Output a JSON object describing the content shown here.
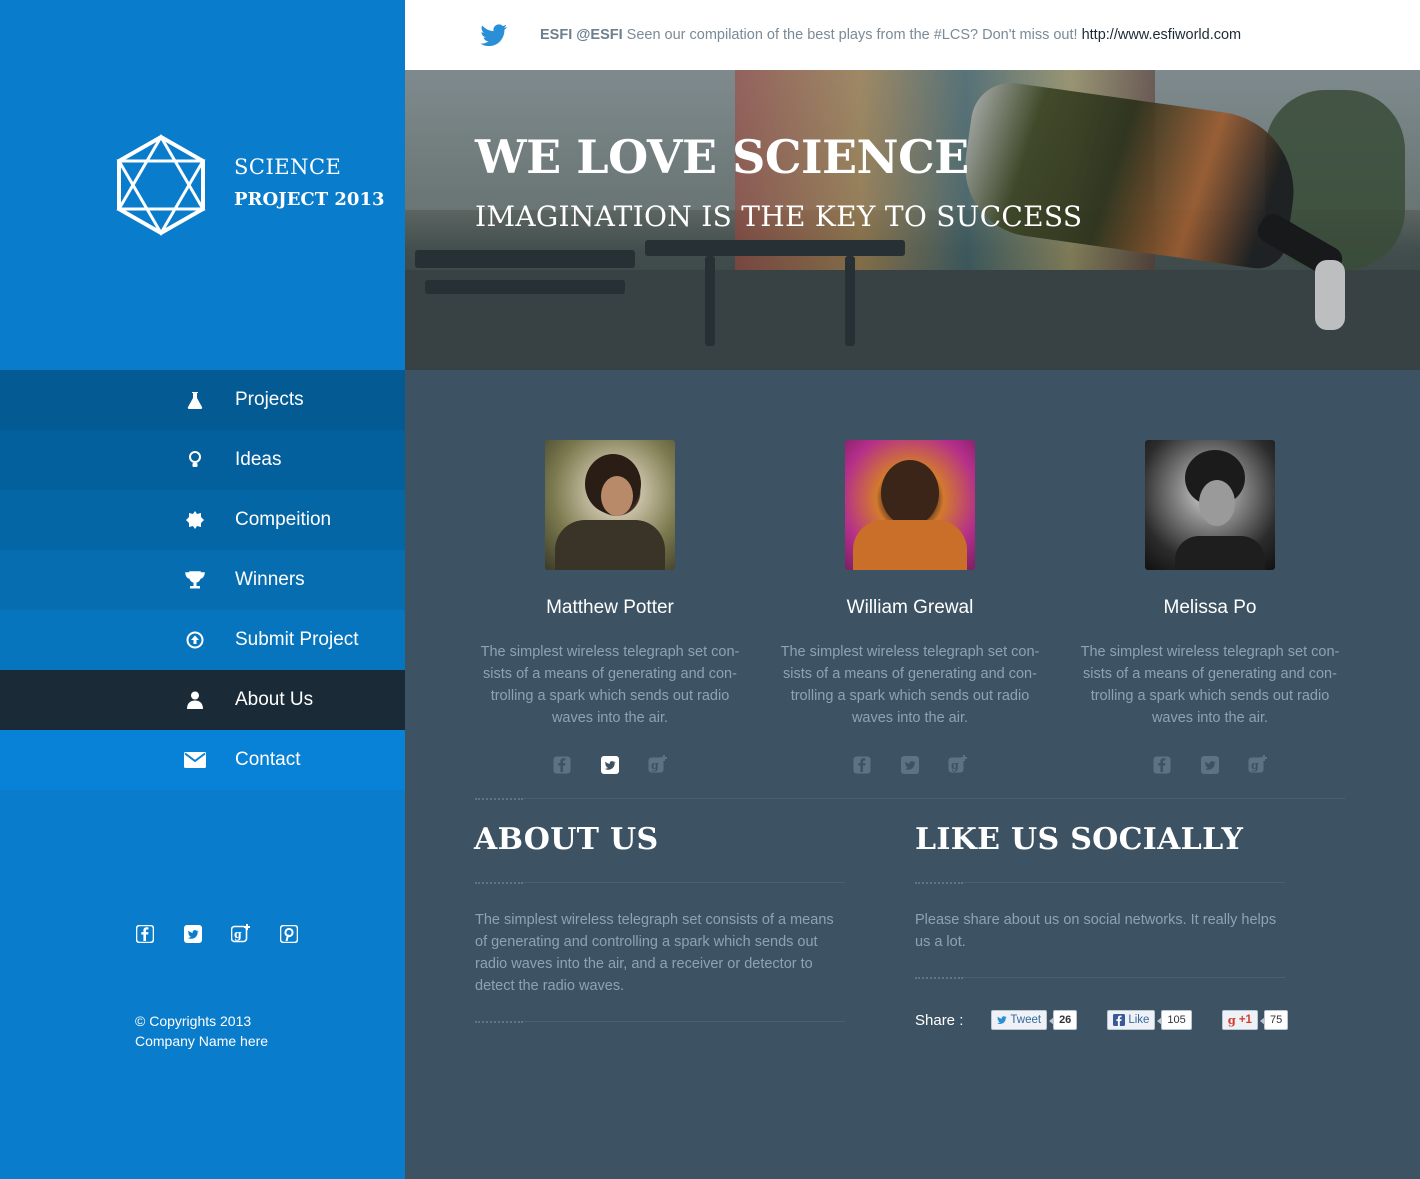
{
  "brand": {
    "line1": "SCIENCE",
    "line2": "PROJECT 2013"
  },
  "nav": [
    {
      "label": "Projects",
      "icon": "flask-icon"
    },
    {
      "label": "Ideas",
      "icon": "lightbulb-icon"
    },
    {
      "label": "Compeition",
      "icon": "badge-icon"
    },
    {
      "label": "Winners",
      "icon": "trophy-icon"
    },
    {
      "label": "Submit Project",
      "icon": "upload-circle-icon"
    },
    {
      "label": "About Us",
      "icon": "user-icon",
      "active": true
    },
    {
      "label": "Contact",
      "icon": "envelope-icon"
    }
  ],
  "footer": {
    "copyright": "© Copyrights 2013",
    "company": "Company Name here"
  },
  "twitter": {
    "handle": "ESFI @ESFI",
    "text": "Seen our compilation of the best plays from the #LCS? Don't miss out!",
    "link": "http://www.esfiworld.com"
  },
  "hero": {
    "title_light": "WE LOVE",
    "title_bold": "SCIENCE",
    "subtitle": "IMAGINATION IS THE KEY TO SUCCESS"
  },
  "team": [
    {
      "name": "Matthew Potter",
      "bio": "The simplest wireless telegraph set con-sists of a means of generating and con-trolling a spark which sends out radio waves into the air."
    },
    {
      "name": "William Grewal",
      "bio": "The simplest wireless telegraph set con-sists of a means of generating and con-trolling a spark which sends out radio waves into the air."
    },
    {
      "name": "Melissa Po",
      "bio": "The simplest wireless telegraph set con-sists of a means of generating and con-trolling a spark which sends out radio waves into the air."
    }
  ],
  "about": {
    "title": "ABOUT US",
    "text": "The simplest wireless telegraph set consists of a means of generating and controlling a spark which sends out radio waves into the air, and a receiver or detector to detect the radio waves."
  },
  "social": {
    "title_light": "LIKE US",
    "title_bold": "SOCIALLY",
    "text": "Please share about us on social networks. It really helps us a lot.",
    "share_label": "Share :",
    "tweet": {
      "label": "Tweet",
      "count": "26"
    },
    "like": {
      "label": "Like",
      "count": "105"
    },
    "plus": {
      "label": "+1",
      "count": "75"
    }
  },
  "colors": {
    "sidebar": "#0a7ccc",
    "content": "#3d5363",
    "active_nav": "#1b2a37"
  }
}
